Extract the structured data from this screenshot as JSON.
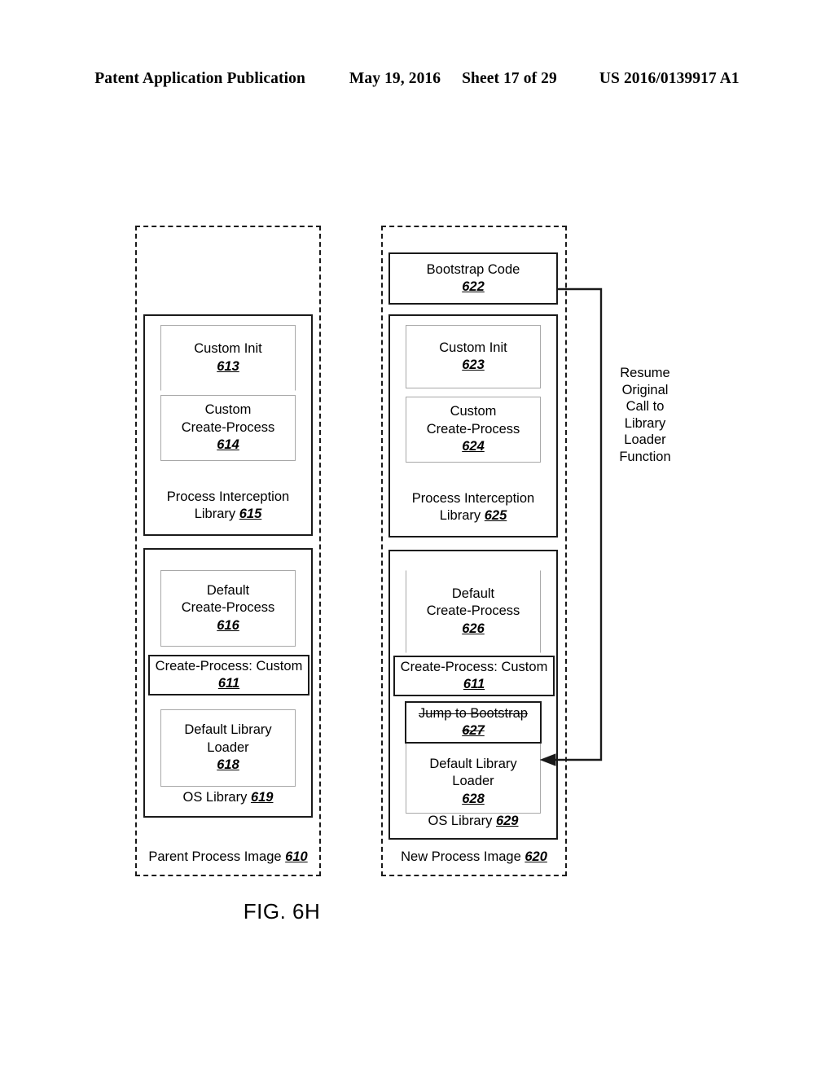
{
  "header": {
    "publication": "Patent Application Publication",
    "date": "May 19, 2016",
    "sheet": "Sheet 17 of 29",
    "patent_number": "US 2016/0139917 A1"
  },
  "figure": {
    "caption": "FIG. 6H",
    "columns": {
      "parent": {
        "container_label": "Parent Process Image",
        "container_ref": "610",
        "interception_library": {
          "label": "Process Interception",
          "label_line2": "Library",
          "ref": "615",
          "items": [
            {
              "label": "Custom Init",
              "ref": "613"
            },
            {
              "label_line1": "Custom",
              "label_line2": "Create-Process",
              "ref": "614"
            }
          ]
        },
        "os_library": {
          "label": "OS Library",
          "ref": "619",
          "items": [
            {
              "label_line1": "Default",
              "label_line2": "Create-Process",
              "ref": "616"
            },
            {
              "label_line1": "Default Library",
              "label_line2": "Loader",
              "ref": "618"
            }
          ],
          "hook": {
            "label": "Create-Process: Custom",
            "ref": "611"
          }
        }
      },
      "new": {
        "container_label": "New Process Image",
        "container_ref": "620",
        "bootstrap": {
          "label": "Bootstrap Code",
          "ref": "622"
        },
        "interception_library": {
          "label": "Process Interception",
          "label_line2": "Library",
          "ref": "625",
          "items": [
            {
              "label": "Custom Init",
              "ref": "623"
            },
            {
              "label_line1": "Custom",
              "label_line2": "Create-Process",
              "ref": "624"
            }
          ]
        },
        "os_library": {
          "label": "OS Library",
          "ref": "629",
          "items": [
            {
              "label_line1": "Default",
              "label_line2": "Create-Process",
              "ref": "626"
            },
            {
              "label_line1": "Default Library",
              "label_line2": "Loader",
              "ref": "628"
            }
          ],
          "hook": {
            "label": "Create-Process: Custom",
            "ref": "611"
          },
          "jump": {
            "label": "Jump to Bootstrap",
            "ref": "627",
            "struck_through": true
          }
        }
      }
    },
    "annotations": {
      "resume_path": "Resume Original Call to Library Loader Function",
      "resume_lines": [
        "Resume",
        "Original",
        "Call to",
        "Library",
        "Loader",
        "Function"
      ]
    }
  },
  "colors": {
    "ink": "#1a1a1a",
    "subbox_border": "#a8a8a8",
    "background": "#ffffff"
  }
}
